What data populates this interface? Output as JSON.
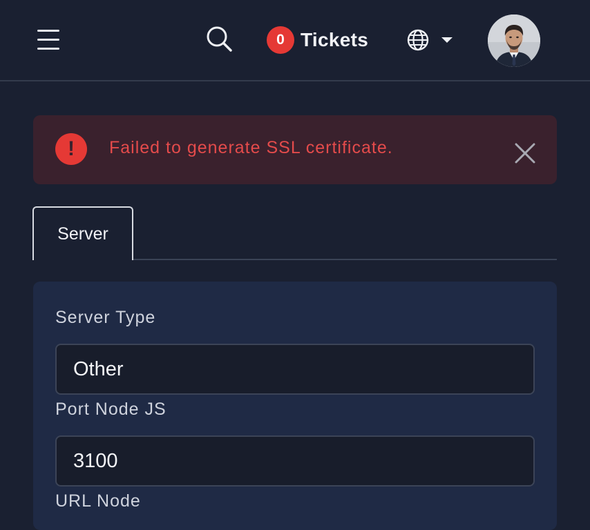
{
  "header": {
    "menu_icon": "hamburger-menu-icon",
    "search_icon": "search-icon",
    "tickets_count": "0",
    "tickets_label": "Tickets",
    "language_icon": "globe-icon",
    "dropdown_icon": "caret-down-icon",
    "avatar_icon": "user-avatar"
  },
  "alert": {
    "icon": "exclamation-circle-icon",
    "message": "Failed to generate SSL certificate.",
    "close_icon": "close-icon",
    "color": "#e53935"
  },
  "tabs": [
    {
      "label": "Server",
      "active": true
    }
  ],
  "form": {
    "server_type": {
      "label": "Server Type",
      "value": "Other"
    },
    "port_node_js": {
      "label": "Port Node JS",
      "value": "3100"
    },
    "url_node": {
      "label": "URL Node"
    }
  },
  "colors": {
    "background": "#1a2031",
    "card": "#1f2a45",
    "badge": "#e53935",
    "alert_bg": "#3a212d",
    "alert_text": "#e44b4b"
  }
}
